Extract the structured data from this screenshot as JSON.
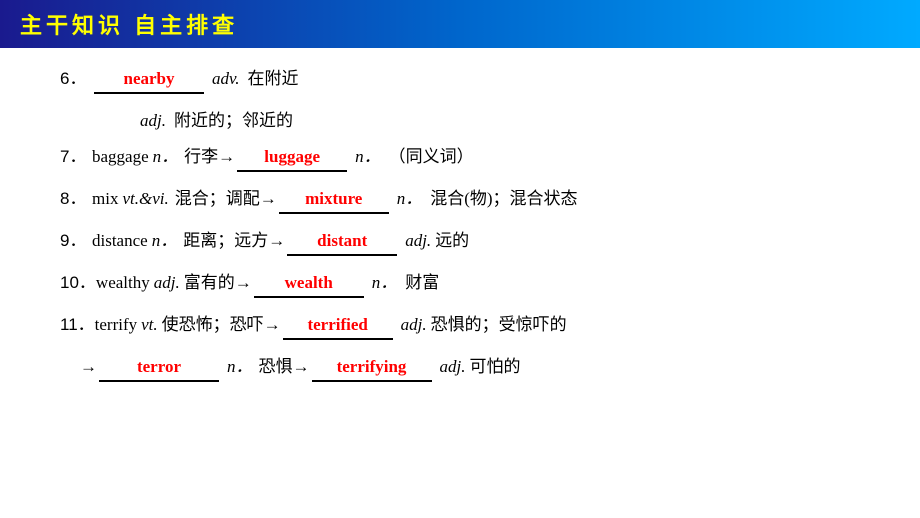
{
  "header": {
    "title": "主干知识  自主排查"
  },
  "items": [
    {
      "num": "6．",
      "word_fill": "nearby",
      "pos1": "adv.",
      "meaning1": "在附近",
      "sub": {
        "pos": "adj.",
        "meaning": "附近的；邻近的"
      }
    },
    {
      "num": "7．",
      "prefix": "baggage",
      "pos_prefix": "n．",
      "meaning_prefix": "行李→",
      "word_fill": "luggage",
      "pos1": "n．",
      "meaning1": "（同义词）"
    },
    {
      "num": "8．",
      "prefix": "mix",
      "pos_prefix": "vt.&vi.",
      "meaning_prefix": "混合；调配→",
      "word_fill": "mixture",
      "pos1": "n．",
      "meaning1": "混合(物)；混合状态"
    },
    {
      "num": "9．",
      "prefix": "distance",
      "pos_prefix": "n．",
      "meaning_prefix": "距离；远方→",
      "word_fill": "distant",
      "pos1": "adj.",
      "meaning1": "远的"
    },
    {
      "num": "10．",
      "prefix": "wealthy",
      "pos_prefix": "adj.",
      "meaning_prefix": "富有的→",
      "word_fill": "wealth",
      "pos1": "n．",
      "meaning1": "财富"
    },
    {
      "num": "11．",
      "prefix": "terrify",
      "pos_prefix": "vt.",
      "meaning_prefix": "使恐怖；恐吓→",
      "word_fill": "terrified",
      "pos1": "adj.",
      "meaning1": "恐惧的；受惊吓的",
      "sub2": {
        "prefix": "→",
        "word_fill": "terror",
        "pos1": "n．",
        "meaning1": "恐惧→",
        "word_fill2": "terrifying",
        "pos2": "adj.",
        "meaning2": "可怕的"
      }
    }
  ]
}
